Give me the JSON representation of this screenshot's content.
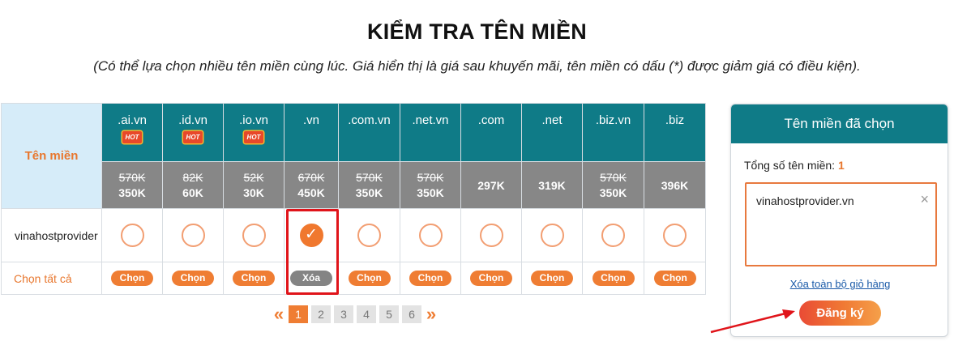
{
  "page": {
    "title": "KIỂM TRA TÊN MIỀN",
    "subtitle": "(Có thể lựa chọn nhiều tên miền cùng lúc. Giá hiển thị là giá sau khuyến mãi, tên miền có dấu (*) được giảm giá có điều kiện)."
  },
  "table": {
    "label_header": "Tên miền",
    "hot_badge": "HOT",
    "extensions": [
      {
        "ext": ".ai.vn",
        "old_price": "570K",
        "new_price": "350K",
        "hot": true,
        "checked": false
      },
      {
        "ext": ".id.vn",
        "old_price": "82K",
        "new_price": "60K",
        "hot": true,
        "checked": false
      },
      {
        "ext": ".io.vn",
        "old_price": "52K",
        "new_price": "30K",
        "hot": true,
        "checked": false
      },
      {
        "ext": ".vn",
        "old_price": "670K",
        "new_price": "450K",
        "hot": false,
        "checked": true
      },
      {
        "ext": ".com.vn",
        "old_price": "570K",
        "new_price": "350K",
        "hot": false,
        "checked": false
      },
      {
        "ext": ".net.vn",
        "old_price": "570K",
        "new_price": "350K",
        "hot": false,
        "checked": false
      },
      {
        "ext": ".com",
        "old_price": "",
        "new_price": "297K",
        "hot": false,
        "checked": false
      },
      {
        "ext": ".net",
        "old_price": "",
        "new_price": "319K",
        "hot": false,
        "checked": false
      },
      {
        "ext": ".biz.vn",
        "old_price": "570K",
        "new_price": "350K",
        "hot": false,
        "checked": false
      },
      {
        "ext": ".biz",
        "old_price": "",
        "new_price": "396K",
        "hot": false,
        "checked": false
      }
    ],
    "domain_name": "vinahostprovider",
    "select_all_label": "Chọn tất cả",
    "choose_label": "Chọn",
    "remove_label": "Xóa",
    "check_glyph": "✓"
  },
  "pagination": {
    "prev": "«",
    "next": "»",
    "pages": [
      "1",
      "2",
      "3",
      "4",
      "5",
      "6"
    ],
    "active": "1"
  },
  "panel": {
    "header": "Tên miền đã chọn",
    "count_label": "Tổng số tên miền:",
    "count": "1",
    "selected_domain": "vinahostprovider.vn",
    "remove_glyph": "×",
    "clear_all": "Xóa toàn bộ giỏ hàng",
    "register": "Đăng ký"
  },
  "colors": {
    "teal": "#0f7b87",
    "orange": "#ef7d33",
    "gray": "#878787",
    "annotation_red": "#e0141a"
  }
}
